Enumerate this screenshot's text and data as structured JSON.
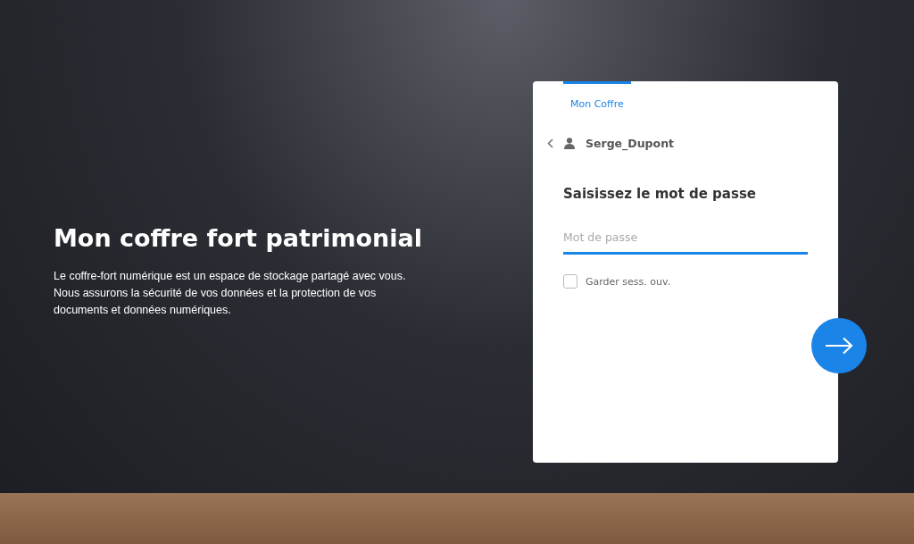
{
  "hero": {
    "title": "Mon coffre fort patrimonial",
    "description": "Le coffre-fort numérique est un espace de stockage partagé avec vous.\nNous assurons la sécurité de vos données et la protection de vos\ndocuments et données numériques."
  },
  "login_card": {
    "tabs": [
      {
        "label": "Mon Coffre",
        "selected": true
      }
    ],
    "user": {
      "name": "Serge_Dupont"
    },
    "heading": "Saisissez le mot de passe",
    "password": {
      "placeholder": "Mot de passe"
    },
    "remember": {
      "label": "Garder sess. ouv.",
      "checked": false
    }
  }
}
